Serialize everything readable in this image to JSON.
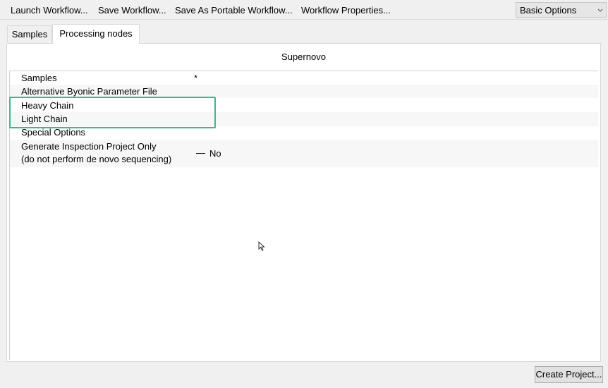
{
  "toolbar": {
    "launch_label": "Launch Workflow...",
    "save_label": "Save Workflow...",
    "save_portable_label": "Save As Portable Workflow...",
    "properties_label": "Workflow Properties...",
    "options_select": {
      "selected": "Basic Options"
    }
  },
  "tabs": [
    {
      "label": "Samples",
      "active": false
    },
    {
      "label": "Processing nodes",
      "active": true
    }
  ],
  "node": {
    "title": "Supernovo"
  },
  "parameters": [
    {
      "label": "Samples",
      "value": "*"
    },
    {
      "label": "Alternative Byonic Parameter File",
      "value": ""
    },
    {
      "label": "Heavy Chain",
      "value": ""
    },
    {
      "label": "Light Chain",
      "value": ""
    },
    {
      "label": "Special Options",
      "value": ""
    },
    {
      "label_line1": "Generate Inspection Project Only",
      "label_line2": "(do not perform de novo sequencing)",
      "value": "No"
    }
  ],
  "footer": {
    "create_label": "Create Project..."
  },
  "colors": {
    "highlight": "#2ebf91"
  }
}
